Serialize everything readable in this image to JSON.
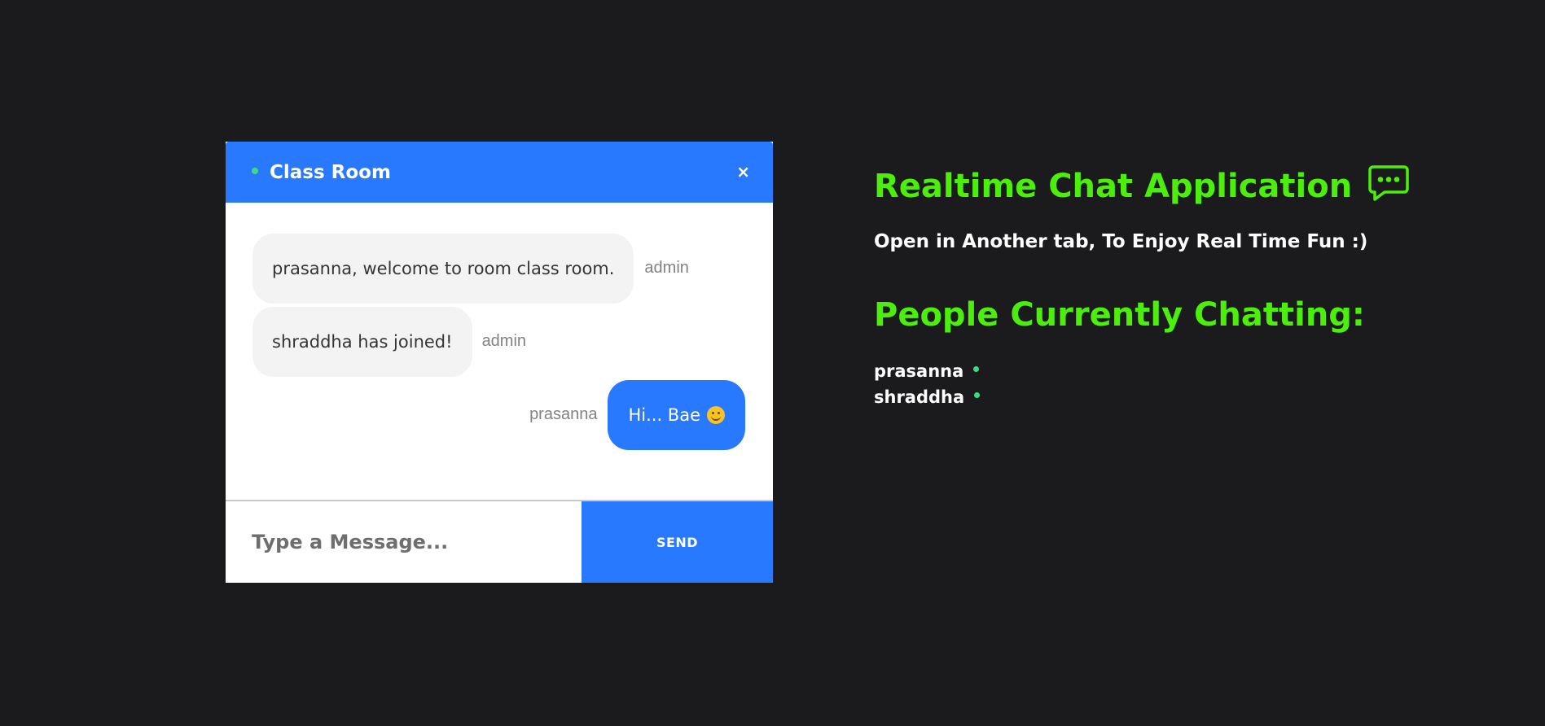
{
  "chat": {
    "room_name": "Class Room",
    "close_label": "×",
    "messages": [
      {
        "text": "prasanna, welcome to room class room.",
        "sender": "admin"
      },
      {
        "text": "shraddha has joined!",
        "sender": "admin"
      },
      {
        "text": "Hi... Bae",
        "sender": "prasanna",
        "emoji": "slightly-smiling-face-icon"
      }
    ],
    "input": {
      "placeholder": "Type a Message...",
      "value": ""
    },
    "send_label": "SEND"
  },
  "info": {
    "title": "Realtime Chat Application",
    "title_icon": "chat-bubble-dots-icon",
    "tagline": "Open in Another tab, To Enjoy Real Time Fun :)",
    "people_title": "People Currently Chatting:",
    "people": [
      "prasanna",
      "shraddha"
    ]
  },
  "colors": {
    "background": "#1b1b1d",
    "accent_blue": "#2979ff",
    "heading_green": "#4cef0c",
    "online_green": "#3ddc84",
    "bubble_gray": "#f3f3f3"
  }
}
